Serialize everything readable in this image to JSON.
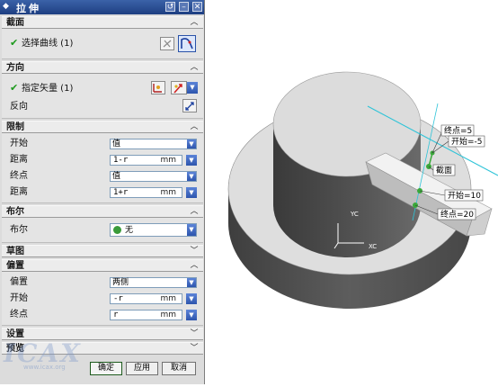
{
  "dialog": {
    "title": "拉伸",
    "sections": {
      "section": {
        "label": "截面",
        "select_curve": "选择曲线 (1)"
      },
      "direction": {
        "label": "方向",
        "specify_vector": "指定矢量 (1)",
        "reverse": "反向"
      },
      "limits": {
        "label": "限制",
        "start_label": "开始",
        "start_value": "值",
        "start_dist_label": "距离",
        "start_dist_value": "1-r",
        "start_unit": "mm",
        "end_label": "终点",
        "end_value": "值",
        "end_dist_label": "距离",
        "end_dist_value": "1+r",
        "end_unit": "mm"
      },
      "boolean": {
        "label": "布尔",
        "boolean_label": "布尔",
        "boolean_value": "无"
      },
      "draft": {
        "label": "草图"
      },
      "offset": {
        "label": "偏置",
        "offset_label": "偏置",
        "offset_value": "两侧",
        "start_label": "开始",
        "start_value": "-r",
        "start_unit": "mm",
        "end_label": "终点",
        "end_value": "r",
        "end_unit": "mm"
      },
      "settings": {
        "label": "设置"
      },
      "preview": {
        "label": "预览"
      }
    },
    "buttons": {
      "ok": "确定",
      "apply": "应用",
      "cancel": "取消"
    },
    "watermark": "ICAX",
    "watermark_url": "www.icax.org"
  },
  "viewport": {
    "labels": {
      "end_point_top": "终点=5",
      "start_top": "开始=-5",
      "section": "截面",
      "start_bottom": "开始=10",
      "end_point_bottom": "终点=20",
      "axis_y": "YC",
      "axis_x": "XC"
    },
    "colors": {
      "background": "#ffffff",
      "solid": "#5a5a5a",
      "accent_line": "#2fc4d8",
      "handle": "#3aa83a"
    }
  }
}
